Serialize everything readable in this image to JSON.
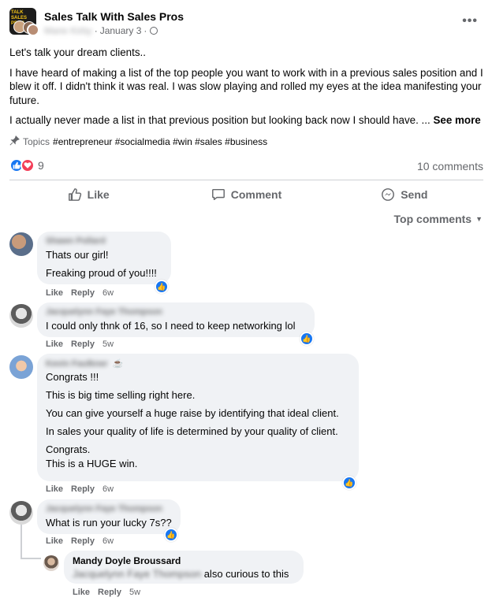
{
  "post": {
    "group_name": "Sales Talk With Sales Pros",
    "author_name": "Marie Kirby",
    "date": "January 3",
    "separator": "·",
    "more_label": "•••",
    "paragraphs": [
      "Let's talk your dream clients..",
      "I have heard of making a list of the top people you want to work with in a previous sales position and I blew it off. I didn't think it was real. I was slow playing and rolled my eyes at the idea manifesting your future.",
      "I actually never made a list in that previous position but looking back now I should have. ..."
    ],
    "see_more": "See more",
    "topics_label": "Topics",
    "topics": "#entrepreneur #socialmedia #win #sales #business",
    "reaction_count": "9",
    "comments_count": "10 comments"
  },
  "actions": {
    "like": "Like",
    "comment": "Comment",
    "send": "Send"
  },
  "sort_label": "Top comments",
  "comments": [
    {
      "name": "Shawn Pollard",
      "lines": [
        "Thats our girl!",
        "Freaking proud of you!!!!"
      ],
      "like": "Like",
      "reply": "Reply",
      "time": "6w"
    },
    {
      "name": "Jacquelynn Faye Thompson",
      "lines": [
        "I could only thnk of 16, so I need to keep networking lol"
      ],
      "like": "Like",
      "reply": "Reply",
      "time": "5w"
    },
    {
      "name": "Kevin Faulkner",
      "lines": [
        "Congrats !!!",
        "This is big time selling right here.",
        "You can give yourself a huge raise by identifying that ideal client.",
        "In sales your quality of life is determined by your quality of client.",
        "Congrats.",
        "This is a HUGE win."
      ],
      "like": "Like",
      "reply": "Reply",
      "time": "6w"
    },
    {
      "name": "Jacquelynn Faye Thompson",
      "lines": [
        "What is run your lucky 7s??"
      ],
      "like": "Like",
      "reply": "Reply",
      "time": "6w"
    },
    {
      "name": "Mandy Doyle Broussard",
      "mention": "Jacquelynn Faye Thompson",
      "text": "also curious to this",
      "like": "Like",
      "reply": "Reply",
      "time": "5w"
    }
  ]
}
